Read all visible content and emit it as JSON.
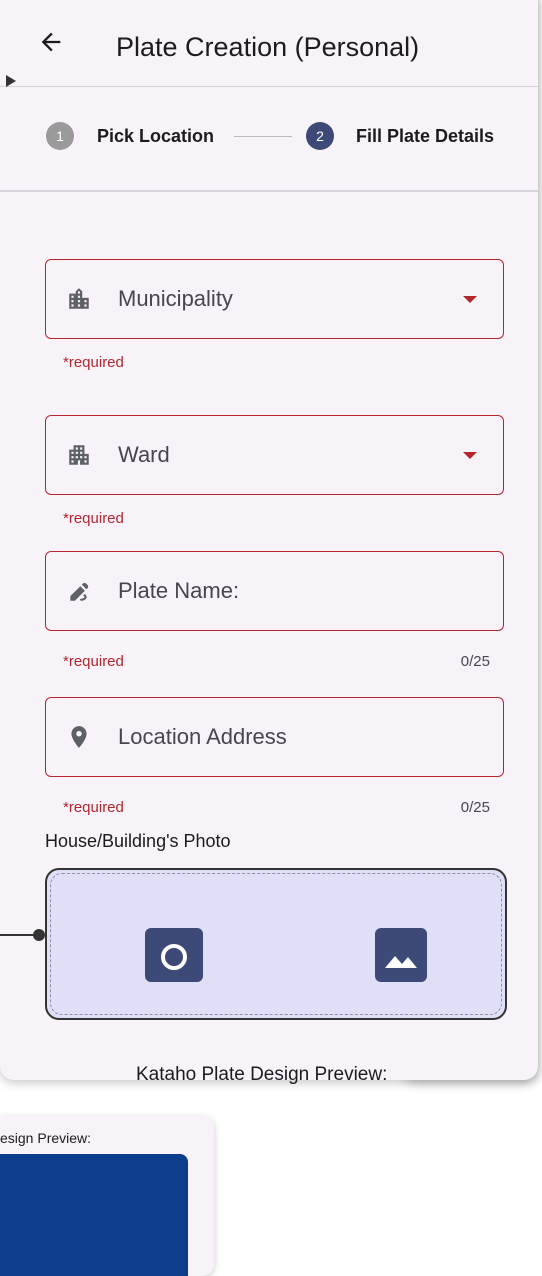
{
  "appbar": {
    "title": "Plate Creation (Personal)",
    "back_icon": "arrow-left-icon"
  },
  "stepper": {
    "steps": [
      {
        "number": "1",
        "label": "Pick Location",
        "state": "inactive"
      },
      {
        "number": "2",
        "label": "Fill Plate Details",
        "state": "active"
      }
    ]
  },
  "form": {
    "municipality": {
      "placeholder": "Municipality",
      "helper": "*required",
      "icon": "building-icon"
    },
    "ward": {
      "placeholder": "Ward",
      "helper": "*required",
      "icon": "apartment-icon"
    },
    "plate_name": {
      "placeholder": "Plate Name:",
      "helper": "*required",
      "counter": "0/25",
      "icon": "pencil-icon"
    },
    "location_address": {
      "placeholder": "Location Address",
      "helper": "*required",
      "counter": "0/25",
      "icon": "location-pin-icon"
    }
  },
  "photo": {
    "label": "House/Building's Photo",
    "camera_icon": "camera-icon",
    "gallery_icon": "image-icon"
  },
  "preview": {
    "label": "Kataho Plate Design Preview:"
  },
  "mini_preview": {
    "label": "esign Preview:"
  },
  "colors": {
    "error": "#b3262e",
    "primary": "#3d4a78",
    "step_active": "#3d4a78",
    "step_inactive": "#9a9a9a",
    "plate": "#0e3d8c"
  }
}
